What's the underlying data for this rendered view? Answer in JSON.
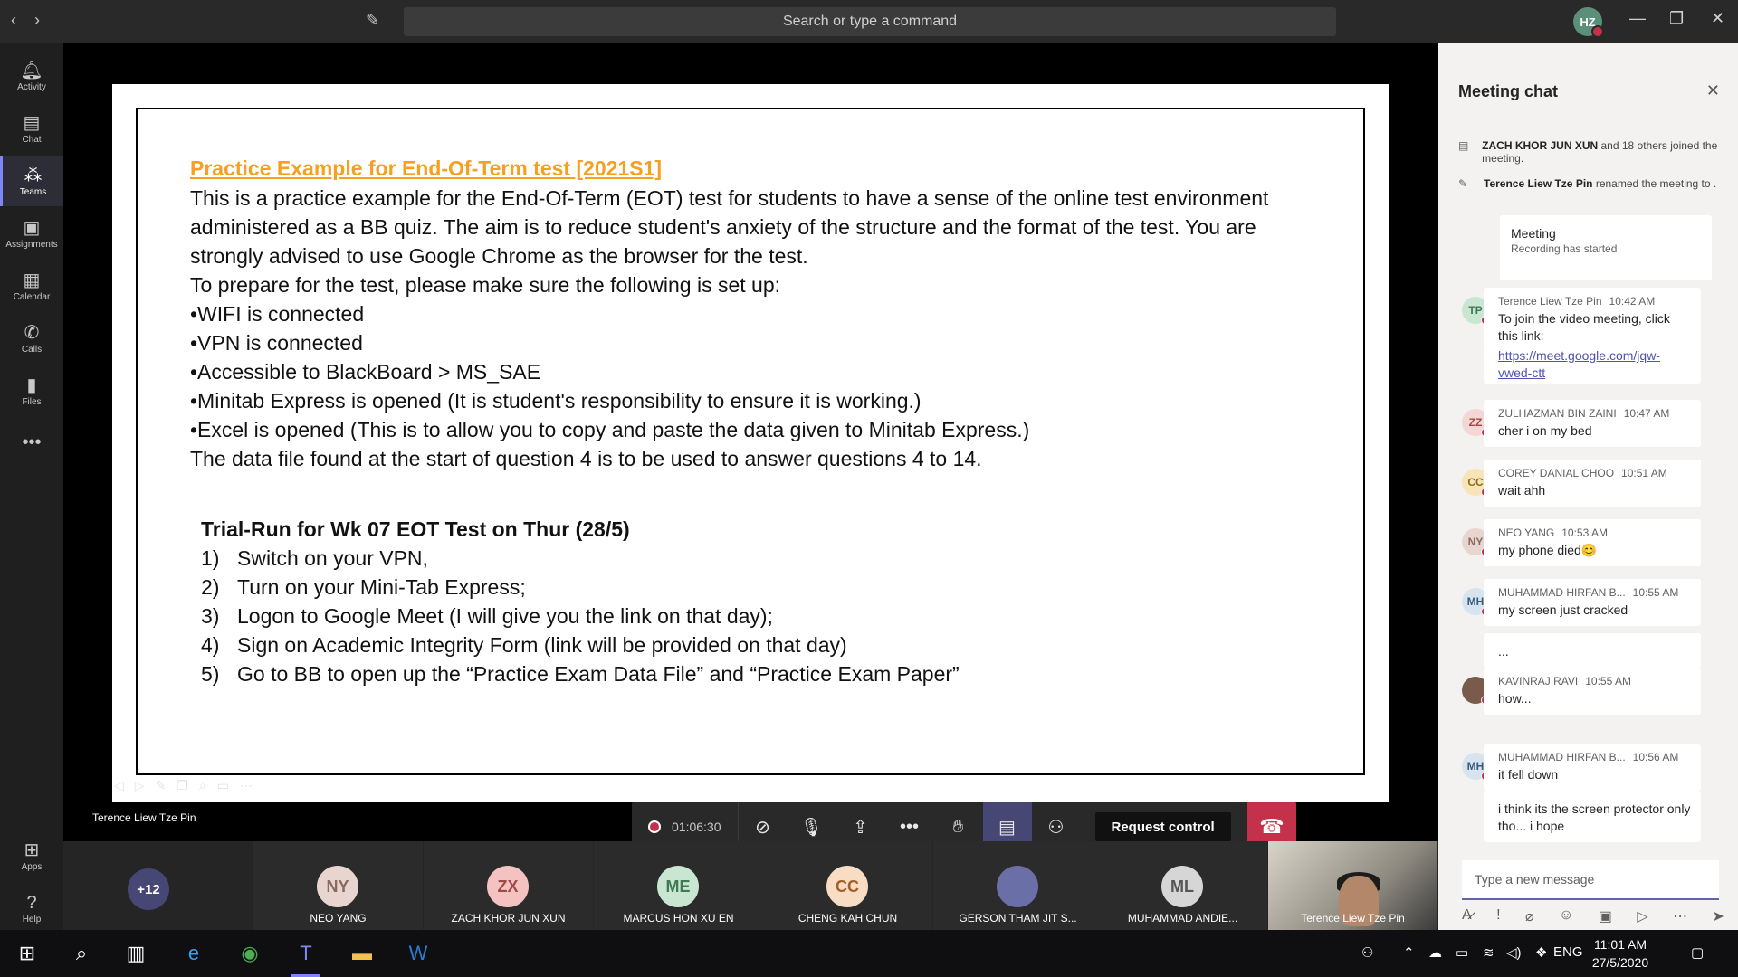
{
  "titlebar": {
    "search_placeholder": "Search or type a command",
    "avatar_initials": "HZ"
  },
  "rail": [
    {
      "label": "Activity",
      "icon": "bell-icon"
    },
    {
      "label": "Chat",
      "icon": "chat-icon"
    },
    {
      "label": "Teams",
      "icon": "teams-icon"
    },
    {
      "label": "Assignments",
      "icon": "assignments-icon"
    },
    {
      "label": "Calendar",
      "icon": "calendar-icon"
    },
    {
      "label": "Calls",
      "icon": "phone-icon"
    },
    {
      "label": "Files",
      "icon": "files-icon"
    },
    {
      "label": "Apps",
      "icon": "apps-icon"
    },
    {
      "label": "Help",
      "icon": "help-icon"
    }
  ],
  "slide": {
    "heading": "Practice Example for End-Of-Term test [2021S1]",
    "lines": [
      "This is a practice example for the End-Of-Term (EOT) test for students to have a sense of the online test environment",
      "administered as a BB quiz. The aim is to reduce student's anxiety of the structure and the format of the test.  You are",
      "strongly advised to use Google Chrome as the browser for the test.",
      "To prepare for the test, please make sure the following is set up:",
      "•WIFI is connected",
      "•VPN is connected",
      "•Accessible to BlackBoard > MS_SAE",
      "•Minitab Express is opened (It is student's responsibility to ensure it is working.)",
      "•Excel is opened (This is to allow you to copy and paste the data given to Minitab Express.)",
      "The data file found at the start of question 4 is to be used to answer questions 4 to 14."
    ],
    "trial_title": "Trial-Run for Wk 07 EOT Test on Thur (28/5)",
    "steps": [
      {
        "num": "1)",
        "text": "Switch on your VPN,"
      },
      {
        "num": "2)",
        "text": "Turn on your Mini-Tab Express;"
      },
      {
        "num": "3)",
        "text": "Logon to Google Meet (I will give you the link on that day);"
      },
      {
        "num": "4)",
        "text": "Sign on Academic Integrity Form (link will be provided on that day)"
      },
      {
        "num": "5)",
        "text": "Go to BB to open up the “Practice Exam Data File” and “Practice Exam Paper”"
      }
    ]
  },
  "presenter_name": "Terence Liew Tze Pin",
  "controls": {
    "timer": "01:06:30",
    "request_control": "Request control"
  },
  "participants": {
    "overflow": "+12",
    "tiles": [
      {
        "initials": "NY",
        "name": "NEO YANG",
        "color": "#e8d5cf"
      },
      {
        "initials": "ZX",
        "name": "ZACH KHOR JUN XUN",
        "color": "#f4c2c0"
      },
      {
        "initials": "ME",
        "name": "MARCUS HON XU EN",
        "color": "#c8e6d2"
      },
      {
        "initials": "CC",
        "name": "CHENG KAH CHUN",
        "color": "#f9dcc4"
      },
      {
        "initials": "",
        "name": "GERSON THAM JIT S...",
        "color": "#6b6fa8"
      },
      {
        "initials": "ML",
        "name": "MUHAMMAD ANDIE...",
        "color": "#d6d6d6"
      }
    ],
    "video_name": "Terence Liew Tze Pin"
  },
  "chat": {
    "title": "Meeting chat",
    "system": [
      {
        "bold": "ZACH KHOR JUN XUN",
        "text": " and 18 others joined the meeting."
      },
      {
        "bold": "Terence Liew Tze Pin",
        "text": " renamed the meeting to ."
      }
    ],
    "meeting_card": {
      "title": "Meeting",
      "subtitle": "Recording has started"
    },
    "messages": [
      {
        "initials": "TP",
        "sender": "Terence Liew Tze Pin",
        "time": "10:42 AM",
        "text": "To join the video meeting, click this link:",
        "link": "https://meet.google.com/jqw-vwed-ctt",
        "color": "#c8e6d2"
      },
      {
        "initials": "ZZ",
        "sender": "ZULHAZMAN BIN ZAINI",
        "time": "10:47 AM",
        "text": "cher i on my bed",
        "color": "#f4d6d6"
      },
      {
        "initials": "CC",
        "sender": "COREY DANIAL CHOO",
        "time": "10:51 AM",
        "text": "wait ahh",
        "color": "#f9e4b7"
      },
      {
        "initials": "NY",
        "sender": "NEO YANG",
        "time": "10:53 AM",
        "text": "my phone died😊",
        "color": "#e8d5cf"
      },
      {
        "initials": "MH",
        "sender": "MUHAMMAD HIRFAN B...",
        "time": "10:55 AM",
        "text": "my screen just cracked",
        "color": "#d6e4ef"
      },
      {
        "initials": "",
        "sender": "",
        "time": "",
        "text": "...",
        "color": ""
      },
      {
        "initials": "",
        "sender": "KAVINRAJ RAVI",
        "time": "10:55 AM",
        "text": "how...",
        "color": "#7a5a4a"
      },
      {
        "initials": "MH",
        "sender": "MUHAMMAD HIRFAN B...",
        "time": "10:56 AM",
        "text": "it fell down",
        "color": "#d6e4ef"
      },
      {
        "initials": "",
        "sender": "",
        "time": "",
        "text": "i think its the screen protector only tho... i hope",
        "color": ""
      }
    ],
    "compose_placeholder": "Type a new message"
  },
  "taskbar": {
    "language": "ENG",
    "time": "11:01 AM",
    "date": "27/5/2020"
  }
}
